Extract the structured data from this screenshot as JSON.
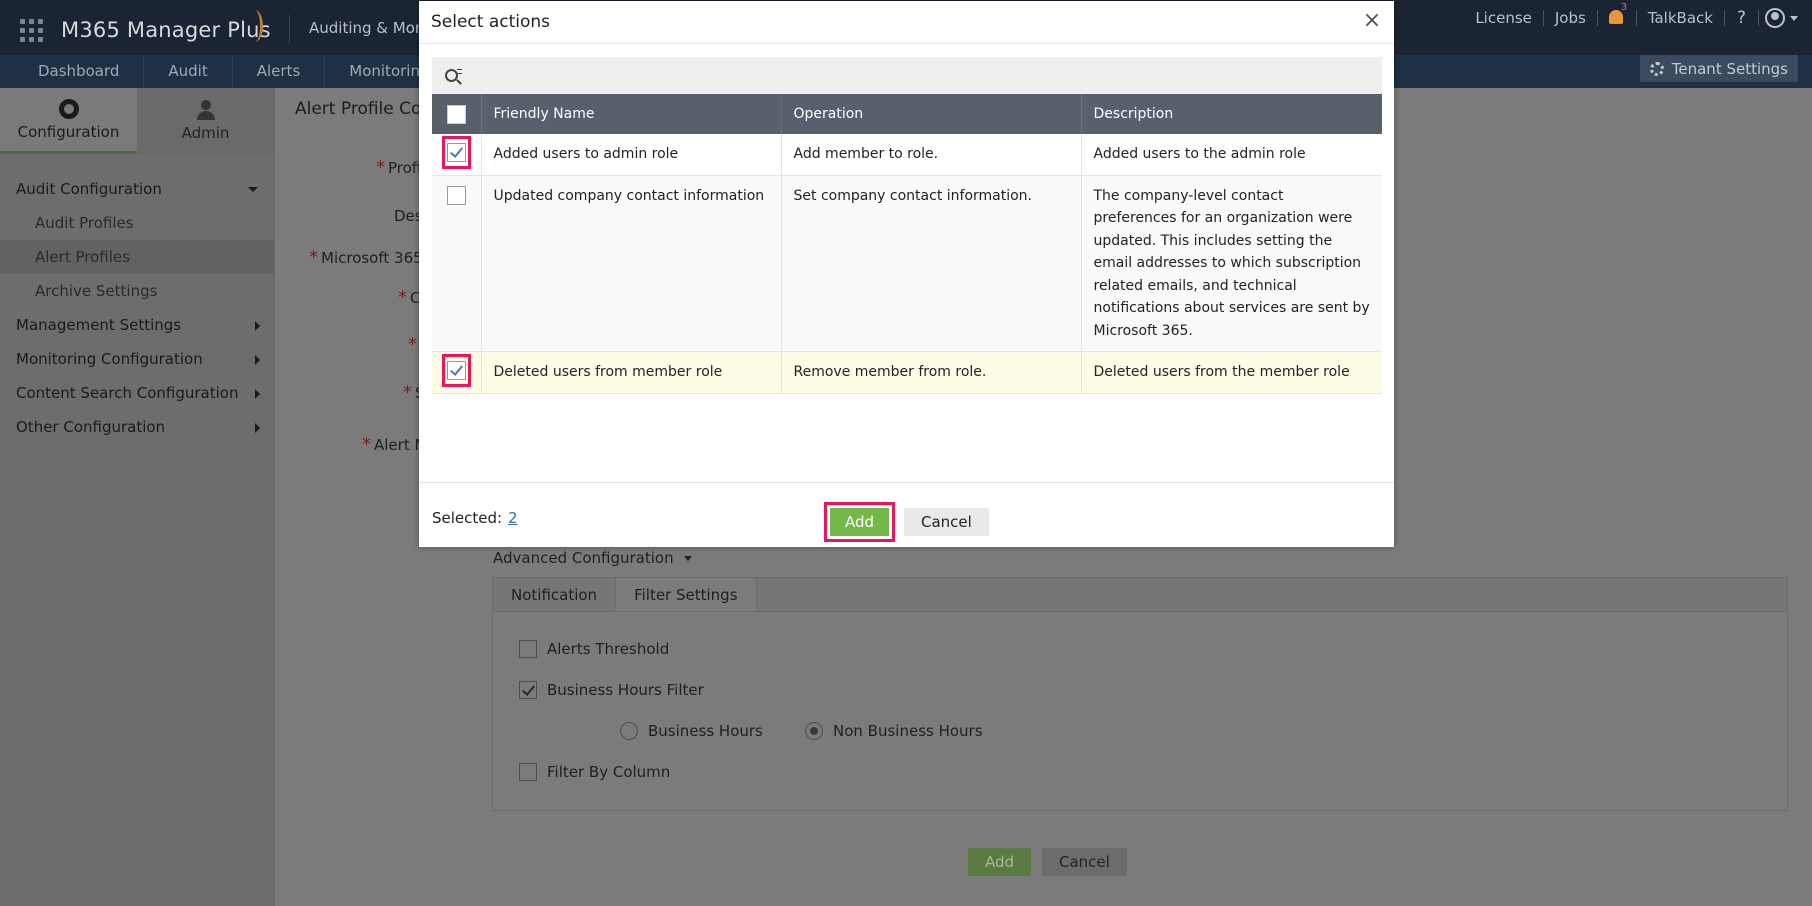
{
  "header": {
    "brand": "M365 Manager Plus",
    "product": "Auditing & Moni",
    "links": [
      "License",
      "Jobs"
    ],
    "notification_count": "3",
    "talkback": "TalkBack",
    "help": "?"
  },
  "nav": {
    "tabs": [
      "Dashboard",
      "Audit",
      "Alerts",
      "Monitoring"
    ],
    "tenant_settings": "Tenant Settings"
  },
  "sidebar": {
    "tabs": [
      {
        "label": "Configuration",
        "icon": "gear-icon"
      },
      {
        "label": "Admin",
        "icon": "admin-icon"
      }
    ],
    "sections": [
      {
        "label": "Audit Configuration",
        "items": [
          "Audit Profiles",
          "Alert Profiles",
          "Archive Settings"
        ]
      },
      {
        "label": "Management Settings"
      },
      {
        "label": "Monitoring Configuration"
      },
      {
        "label": "Content Search Configuration"
      },
      {
        "label": "Other Configuration"
      }
    ]
  },
  "main": {
    "title": "Alert Profile Cor",
    "labels": [
      "Profi",
      "Des",
      "Microsoft 365",
      "C",
      "",
      "S",
      "Alert M"
    ],
    "advanced_configuration": "Advanced Configuration",
    "advanced_tabs": [
      "Notification",
      "Filter Settings"
    ],
    "options": {
      "alerts_threshold": "Alerts Threshold",
      "business_hours_filter": "Business Hours Filter",
      "business_hours": "Business Hours",
      "non_business_hours": "Non Business Hours",
      "filter_by_column": "Filter By Column"
    },
    "add_label": "Add",
    "cancel_label": "Cancel"
  },
  "modal": {
    "title": "Select actions",
    "close": "×",
    "search_placeholder": "",
    "columns": [
      "Friendly Name",
      "Operation",
      "Description"
    ],
    "rows": [
      {
        "name": "Added users to admin role",
        "operation": "Add member to role.",
        "description": "Added users to the admin role",
        "checked": true
      },
      {
        "name": "Updated company contact information",
        "operation": "Set company contact information.",
        "description": "The company-level contact preferences for an organization were updated. This includes setting the email addresses to which subscription related emails, and technical notifications about services are sent by Microsoft 365.",
        "checked": false
      },
      {
        "name": "Deleted users from member role",
        "operation": "Remove member from role.",
        "description": "Deleted users from the member role",
        "checked": true
      }
    ],
    "selected_label": "Selected:",
    "selected_count": "2",
    "add_label": "Add",
    "cancel_label": "Cancel"
  }
}
